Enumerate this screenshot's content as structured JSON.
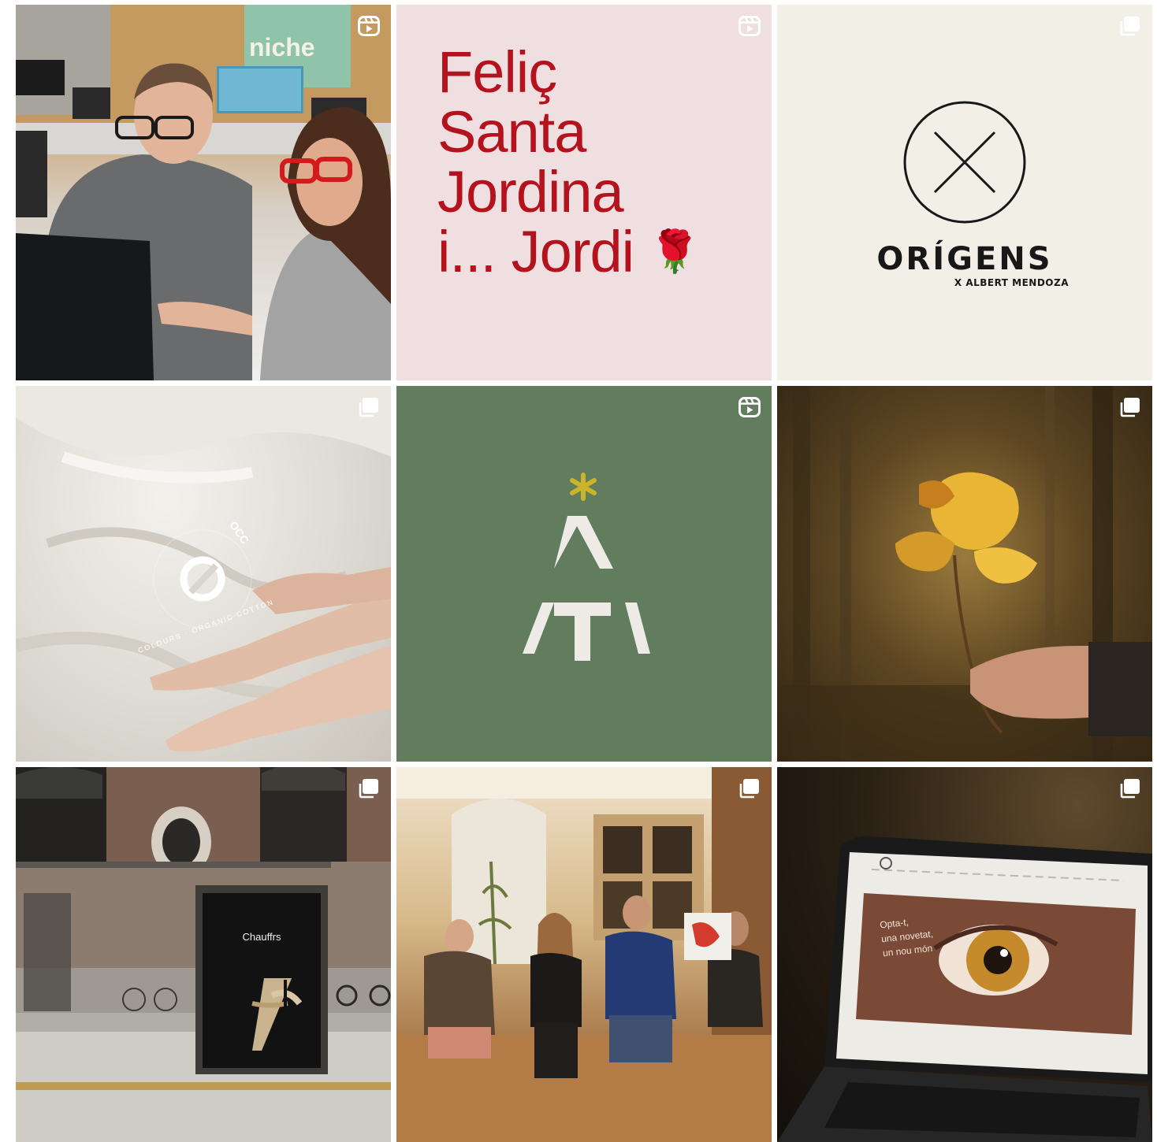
{
  "posts": [
    {
      "kind": "reel",
      "alt": "Two people working at a computer in an office",
      "sign": "niche"
    },
    {
      "kind": "reel",
      "lines": [
        "Feliç",
        "Santa",
        "Jordina",
        "i... Jordi"
      ],
      "emoji": "🌹"
    },
    {
      "kind": "carousel",
      "title": "ORÍGENS",
      "subtitle": "X ALBERT MENDOZA"
    },
    {
      "kind": "carousel",
      "badge_text": "OCC",
      "ring_text": "COLOURS · ORGANIC COTTON"
    },
    {
      "kind": "reel"
    },
    {
      "kind": "carousel"
    },
    {
      "kind": "carousel",
      "poster_title": "Chauffrs"
    },
    {
      "kind": "carousel"
    },
    {
      "kind": "carousel",
      "screen_lines": [
        "Opta-t,",
        "una novetat,",
        "un nou món"
      ]
    }
  ],
  "colors": {
    "jordi_red": "#b4121d",
    "jordi_bg": "#efdfe1",
    "green_bg": "#627c5e",
    "asterisk": "#cbb42a",
    "origens_bg": "#f1efe6"
  }
}
